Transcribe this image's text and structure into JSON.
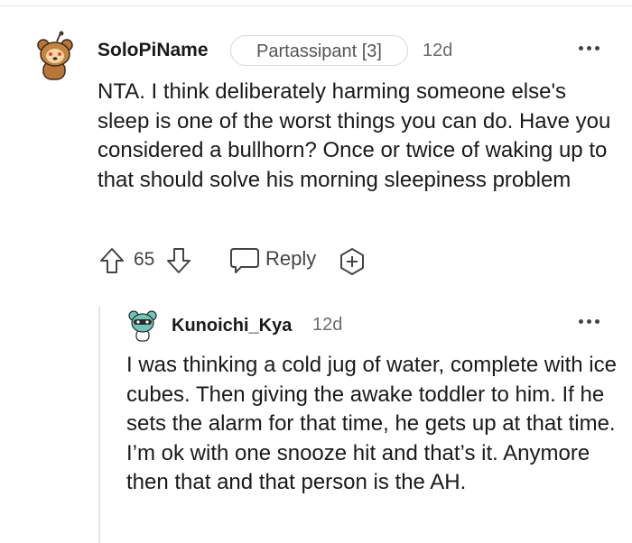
{
  "parent_comment": {
    "username": "SoloPiName",
    "flair": "Partassipant [3]",
    "time": "12d",
    "body": "NTA. I think deliberately harming someone else's sleep is one of the worst things you can do. Have you considered a bullhorn? Once or twice of waking up to that should solve his morning sleepiness problem",
    "votes": "65",
    "reply_label": "Reply"
  },
  "reply_comment": {
    "username": "Kunoichi_Kya",
    "time": "12d",
    "body": "I was thinking a cold jug of water, complete with ice cubes. Then giving the awake toddler to him. If he sets the alarm for that time, he gets up at that time. I’m ok with one snooze hit and that’s it. Anymore then that and that person is the AH."
  },
  "icons": {
    "upvote": "upvote-arrow-icon",
    "downvote": "downvote-arrow-icon",
    "reply": "speech-bubble-icon",
    "award": "award-plus-icon",
    "more": "more-dots-icon"
  },
  "colors": {
    "text": "#1a1a1b",
    "meta": "#6b6b6b",
    "divider": "#e4e4e4"
  }
}
